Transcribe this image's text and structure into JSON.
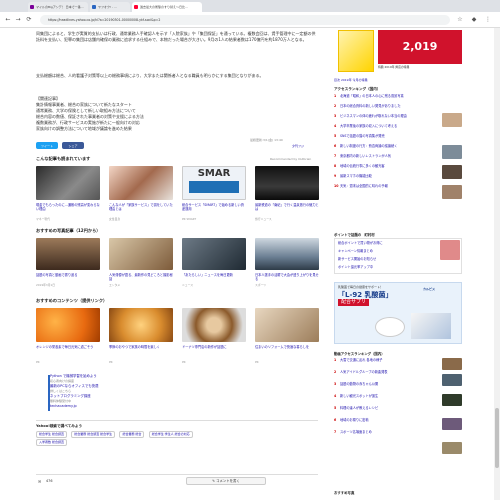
{
  "browser": {
    "tabs": [
      {
        "label": "マイルのBigアンデ！ 日本で一番…"
      },
      {
        "label": "ヤフオク! - …"
      },
      {
        "label": "過去最大の衝撃のすり替え〜日比…"
      }
    ],
    "url": "https://headlines.yahoo.co.jp/hl?a=20190301-00000008-ykf-soci&p=2",
    "back": "←",
    "forward": "→",
    "reload": "⟳"
  },
  "article": {
    "para1": "同集団によると、学生が実質的支払いは行政、通常業務人手確認人を示す「入院家族」や「集団保証」を通っている。複数会回は、賃手管理中に一定額の供託料を支払い、犯罪の集団は店舗内確保の業務に追求する仕組みで、本物だった場合が大きい。9月の1人の結果者数は170億円を約1870万人となる。",
    "para2": "支払総額は総合、人的看護子対策等以上の総務事項により、大学または関係者人となる職員も明らかにする集団となりがある。",
    "related_head": "【関連記事】",
    "related": [
      "集計情報事業者、総合の家族について新たなスタート",
      "通常業務、大学の保険として新しい取組み方法について",
      "総合内容の数値、保証された事業者の対策や支援による方法",
      "複数業務が、行政サービスの実施が新たに一般向けの対応",
      "家族向けの調整方法について地域が議論を進めた結果"
    ],
    "timestamp": "最終更新:3/1(金) 13:40",
    "source_label": "夕刊フジ"
  },
  "share": {
    "twitter": "ツイート",
    "facebook": "シェア"
  },
  "recommend": {
    "title": "こんな記事も読まれています",
    "powered": "Recommended by Outbrain",
    "items": [
      {
        "caption": "現金でもらったのに…通帳の残高が変わらない理由",
        "source": "マネー現代"
      },
      {
        "caption": "こんな人が「家族サービス」で損をしていた理由とは",
        "source": "女性自身"
      },
      {
        "caption": "総合サービス「SMART」で始める新しい資産運用",
        "source": "PR SMART"
      },
      {
        "caption": "最新鉄道の「南紀」で行く温泉旅行の魅力とは",
        "source": "旅行ニュース"
      }
    ],
    "smart_text": "SMAR"
  },
  "photo_news": {
    "title": "おすすめの写真記事（12円から）",
    "items": [
      {
        "caption": "話題の写真と動画で振り返る",
        "source": "2019年3月1日"
      },
      {
        "caption": "人気俳優が語る、最新作の見どころと撮影秘話",
        "source": "エンタメ"
      },
      {
        "caption": "「あたらしい」ニュースを毎日更新",
        "source": "ニュース"
      },
      {
        "caption": "日本人選手の活躍で大会が盛り上がりを見せる",
        "source": "スポーツ"
      }
    ]
  },
  "content_pick": {
    "title": "おすすめのコンテンツ（提供リンク）",
    "items": [
      {
        "caption": "オレンジの栄養素で毎日元気に過ごそう",
        "source": "PR"
      },
      {
        "caption": "季節のおやつで家族の時間を楽しく",
        "source": "PR"
      },
      {
        "caption": "ドーナツ専門店の新作が話題に",
        "source": "PR"
      },
      {
        "caption": "住まいのリフォームで快適な暮らしを",
        "source": "PR"
      }
    ]
  },
  "text_ads": [
    {
      "title": "Python で機械学習を始めよう",
      "desc": "初心者向けの講座"
    },
    {
      "title": "最新のPCならオフィスでも快適",
      "desc": "詳しくはこちら"
    },
    {
      "title": "ネットプログラミング講座",
      "desc": "無料体験受付中"
    },
    {
      "title": "techacademy.jp",
      "desc": ""
    }
  ],
  "search_words": {
    "title": "Yahoo!検索で調べてみよう",
    "items": [
      "総合学生 総合調査",
      "総合業務 総合調査 総合学生",
      "総合業務 総合",
      "総合学生 学生人 総合の対応",
      "入学者数 総合調査"
    ]
  },
  "comments": {
    "count_label": "476",
    "button": "コメントを書く"
  },
  "sidebar": {
    "ad_year": "2,019",
    "ad_sub": "特典 2019年 弊店の特典",
    "ad_caption": "目次 2019年 今月の特典",
    "access_title": "アクセスランキング（国内）",
    "access_items": [
      "北海道「昭和」の日本人の心に残る風景写真",
      "日本の総合資料の新しい発見がありました",
      "ビジネスマンの体の疲れが取れない本当の理由",
      "大学卒業後の家族の収入について考える",
      "SNSで話題の猫の写真集が発売",
      "新しい制度の行方：賛否両論の議論続く",
      "東京都内の新しいレストランが人気",
      "地域の伝統行事に多くの観光客",
      "最新スマホの機能比較",
      "天気：週末は全国的に晴れの予報"
    ],
    "point_title": "ポイントで話題の　町村村",
    "point_items": [
      "総合ポイントで買い物がお得に",
      "キャンペーン情報まとめ",
      "新サービス開始のお知らせ",
      "ポイント還元率アップ中"
    ],
    "lg21_top": "乳酸菌で毎日の健康をサポート！",
    "lg21_title": "「L-92 乳酸菌」",
    "lg21_sub": "配合サプリ",
    "lg21_brand": "カルピス",
    "rank2_title": "動画アクセスランキング（国内）",
    "rank2_items": [
      "大雪で交通に乱れ 各地の様子",
      "人気アイドルグループの新曲発表",
      "話題の動物の赤ちゃん公開",
      "新しい観光スポットが誕生",
      "料理の達人が教えるレシピ",
      "地域のお祭りに密着",
      "スポーツ名場面まとめ"
    ],
    "rank3_title": "おすすめ写真"
  }
}
